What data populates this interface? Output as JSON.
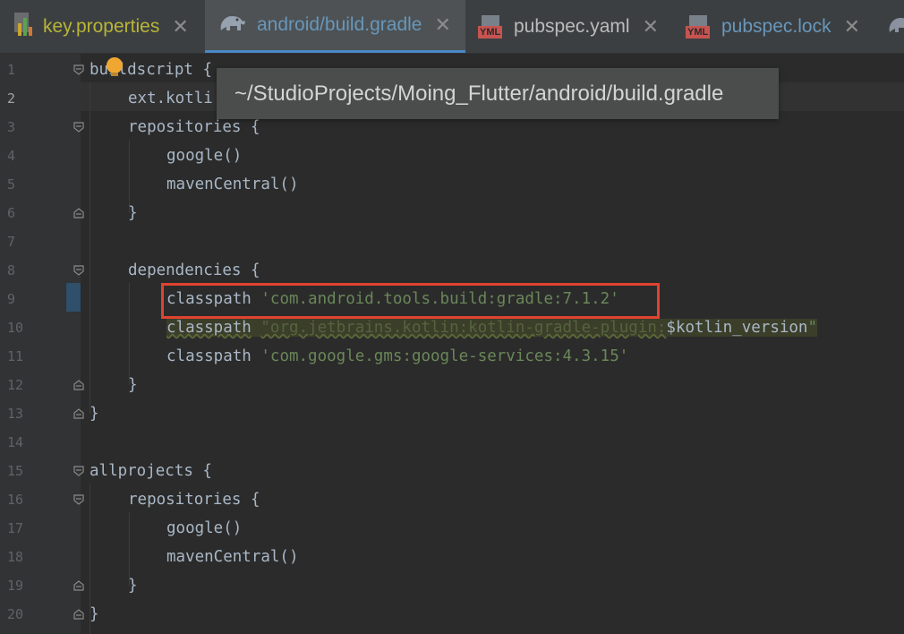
{
  "tabs": [
    {
      "label": "key.properties",
      "icon": "properties-file-icon",
      "color": "#b8b538"
    },
    {
      "label": "android/build.gradle",
      "icon": "gradle-elephant-icon",
      "color": "#6897bb",
      "active": true
    },
    {
      "label": "pubspec.yaml",
      "icon": "yml-file-icon",
      "color": "#bbbbbb"
    },
    {
      "label": "pubspec.lock",
      "icon": "yml-file-icon",
      "color": "#6897bb"
    }
  ],
  "yml_badge": "YML",
  "close_glyph": "✕",
  "tooltip": "~/StudioProjects/Moing_Flutter/android/build.gradle",
  "line_numbers": [
    "1",
    "2",
    "3",
    "4",
    "5",
    "6",
    "7",
    "8",
    "9",
    "10",
    "11",
    "12",
    "13",
    "14",
    "15",
    "16",
    "17",
    "18",
    "19",
    "20"
  ],
  "code": {
    "l1_kw": "buildscript",
    "l1_brace": " {",
    "l2": "ext.kotli",
    "l3": "repositories {",
    "l4": "google()",
    "l5": "mavenCentral()",
    "l6": "}",
    "l8": "dependencies {",
    "l9_kw": "classpath",
    "l9_str": "'com.android.tools.build:gradle:7.1.2'",
    "l10_kw": "classpath",
    "l10_str": "\"org.jetbrains.kotlin:kotlin-gradle-plugin:",
    "l10_tmpl": "$kotlin_version",
    "l10_end": "\"",
    "l11_kw": "classpath",
    "l11_str": "'com.google.gms:google-services:4.3.15'",
    "l12": "}",
    "l13": "}",
    "l15": "allprojects {",
    "l16": "repositories {",
    "l17": "google()",
    "l18": "mavenCentral()",
    "l19": "}",
    "l20": "}"
  },
  "colors": {
    "keyword": "#cc7832",
    "string": "#6a8759",
    "text": "#a9b7c6",
    "highlight_box": "#e0432f",
    "active_tab_underline": "#4a88c7"
  }
}
